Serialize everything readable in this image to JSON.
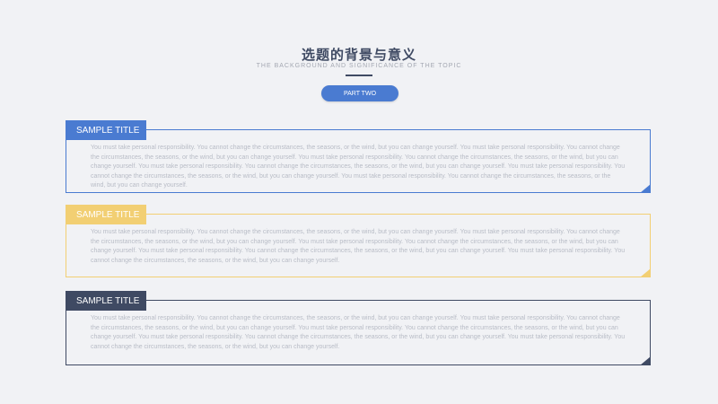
{
  "header": {
    "title": "选题的背景与意义",
    "subtitle": "THE BACKGROUND AND SIGNIFICANCE OF THE TOPIC",
    "part_label": "PART TWO"
  },
  "colors": {
    "blue": "#4a7bd1",
    "yellow": "#f2cf73",
    "navy": "#3f4a63"
  },
  "cards": [
    {
      "title": "SAMPLE TITLE",
      "text": "You must take personal responsibility. You cannot change the circumstances, the seasons, or the wind, but you can change yourself. You must take personal responsibility. You cannot change the circumstances, the seasons, or the wind, but you can change yourself. You must take personal responsibility. You cannot change the circumstances, the seasons, or the wind, but you can change yourself. You must take personal responsibility. You cannot change the circumstances, the seasons, or the wind, but you can change yourself. You must take personal responsibility. You cannot change the circumstances, the seasons, or the wind, but you can change yourself. You must take personal responsibility. You cannot change the circumstances, the seasons, or the wind, but you can change yourself."
    },
    {
      "title": "SAMPLE TITLE",
      "text": "You must take personal responsibility. You cannot change the circumstances, the seasons, or the wind, but you can change yourself. You must take personal responsibility. You cannot change the circumstances, the seasons, or the wind, but you can change yourself. You must take personal responsibility. You cannot change the circumstances, the seasons, or the wind, but you can change yourself. You must take personal responsibility. You cannot change the circumstances, the seasons, or the wind, but you can change yourself. You must take personal responsibility. You cannot change the circumstances, the seasons, or the wind, but you can change yourself."
    },
    {
      "title": "SAMPLE TITLE",
      "text": "You must take personal responsibility. You cannot change the circumstances, the seasons, or the wind, but you can change yourself. You must take personal responsibility. You cannot change the circumstances, the seasons, or the wind, but you can change yourself. You must take personal responsibility. You cannot change the circumstances, the seasons, or the wind, but you can change yourself. You must take personal responsibility. You cannot change the circumstances, the seasons, or the wind, but you can change yourself. You must take personal responsibility. You cannot change the circumstances, the seasons, or the wind, but you can change yourself."
    }
  ]
}
